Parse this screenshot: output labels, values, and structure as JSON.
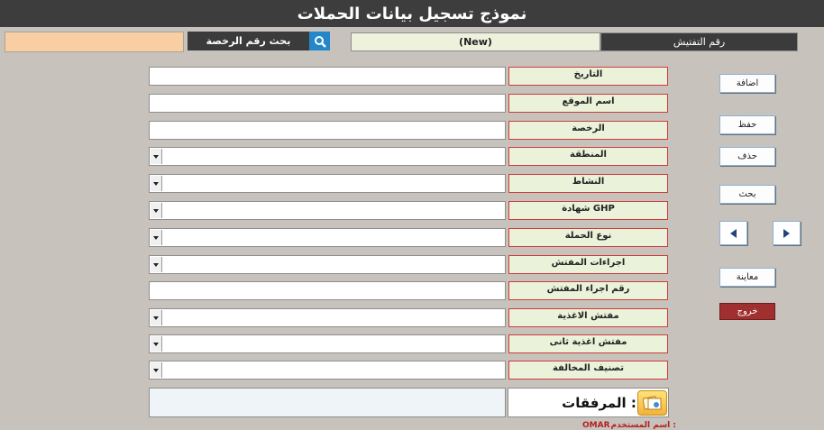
{
  "window": {
    "title": "نموذج تسجيل بيانات الحملات"
  },
  "search": {
    "value": "",
    "label": "بحث رقم الرخصة",
    "button_icon": "search-icon"
  },
  "inspection": {
    "value": "(New)",
    "label": "رقم التفتيش"
  },
  "fields": [
    {
      "label": "التاريخ",
      "value": "",
      "dropdown": false
    },
    {
      "label": "اسم الموقع",
      "value": "",
      "dropdown": false
    },
    {
      "label": "الرخصة",
      "value": "",
      "dropdown": false
    },
    {
      "label": "المنطقة",
      "value": "",
      "dropdown": true
    },
    {
      "label": "النشاط",
      "value": "",
      "dropdown": true
    },
    {
      "label": "شهادة GHP",
      "value": "",
      "dropdown": true
    },
    {
      "label": "نوع الحملة",
      "value": "",
      "dropdown": true
    },
    {
      "label": "اجراءات المفتش",
      "value": "",
      "dropdown": true
    },
    {
      "label": "رقم اجراء المفتش",
      "value": "",
      "dropdown": false
    },
    {
      "label": "مفتش الاغذية",
      "value": "",
      "dropdown": true
    },
    {
      "label": "مفتش اغذية ثانى",
      "value": "",
      "dropdown": true
    },
    {
      "label": "تصنيف المخالفة",
      "value": "",
      "dropdown": true
    }
  ],
  "buttons": {
    "add": "اضافة",
    "save": "حفظ",
    "delete": "حذف",
    "search": "بحث",
    "preview": "معاينة",
    "exit": "خروج",
    "prev_icon": "triangle-left-icon",
    "next_icon": "triangle-right-icon"
  },
  "attachments": {
    "label": "المرفقات :",
    "icon": "attachment-icon"
  },
  "user": {
    "label": "اسم المستخدم :",
    "name": "OMAR"
  },
  "colors": {
    "background": "#c7c3bc",
    "title_bar": "#3d3d3d",
    "label_border": "#d23a3a",
    "label_fill": "#eaf2d9",
    "search_value_fill": "#f9cea2",
    "search_button": "#2487c9",
    "exit_button": "#a03030"
  }
}
